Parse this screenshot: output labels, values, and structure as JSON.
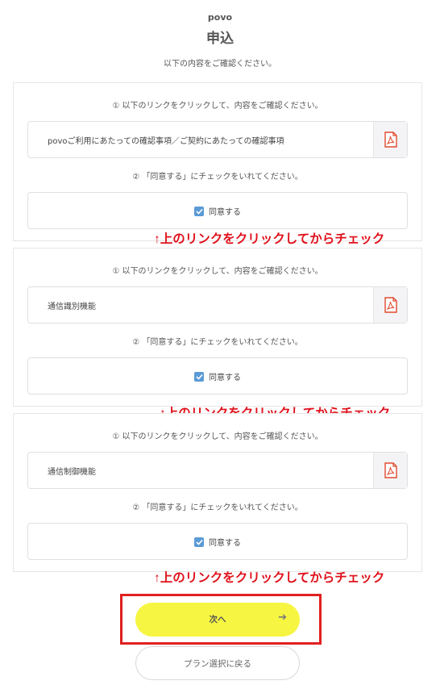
{
  "header": {
    "brand": "povo",
    "title": "申込",
    "subtitle": "以下の内容をご確認ください。"
  },
  "sections": [
    {
      "instruction_link": "① 以下のリンクをクリックして、内容をご確認ください。",
      "link_text": "povoご利用にあたっての確認事項／ご契約にあたっての確認事項",
      "instruction_check": "② 「同意する」にチェックをいれてください。",
      "agree_label": "同意する",
      "checked": true
    },
    {
      "instruction_link": "① 以下のリンクをクリックして、内容をご確認ください。",
      "link_text": "通信識別機能",
      "instruction_check": "② 「同意する」にチェックをいれてください。",
      "agree_label": "同意する",
      "checked": true
    },
    {
      "instruction_link": "① 以下のリンクをクリックして、内容をご確認ください。",
      "link_text": "通信制御機能",
      "instruction_check": "② 「同意する」にチェックをいれてください。",
      "agree_label": "同意する",
      "checked": true
    }
  ],
  "annotations": [
    "↑上のリンクをクリックしてからチェック",
    "↑上のリンクをクリックしてからチェック",
    "↑上のリンクをクリックしてからチェック"
  ],
  "buttons": {
    "next_label": "次へ",
    "back_label": "プラン選択に戻る"
  },
  "icons": {
    "link_icon": "pdf-icon",
    "checkbox_icon": "checkmark-icon",
    "next_arrow": "arrow-right-icon"
  },
  "colors": {
    "primary_button": "#f6f642",
    "checkbox": "#5b9bd5",
    "annotation": "#e0111b",
    "pdf_icon": "#e04a2f"
  }
}
